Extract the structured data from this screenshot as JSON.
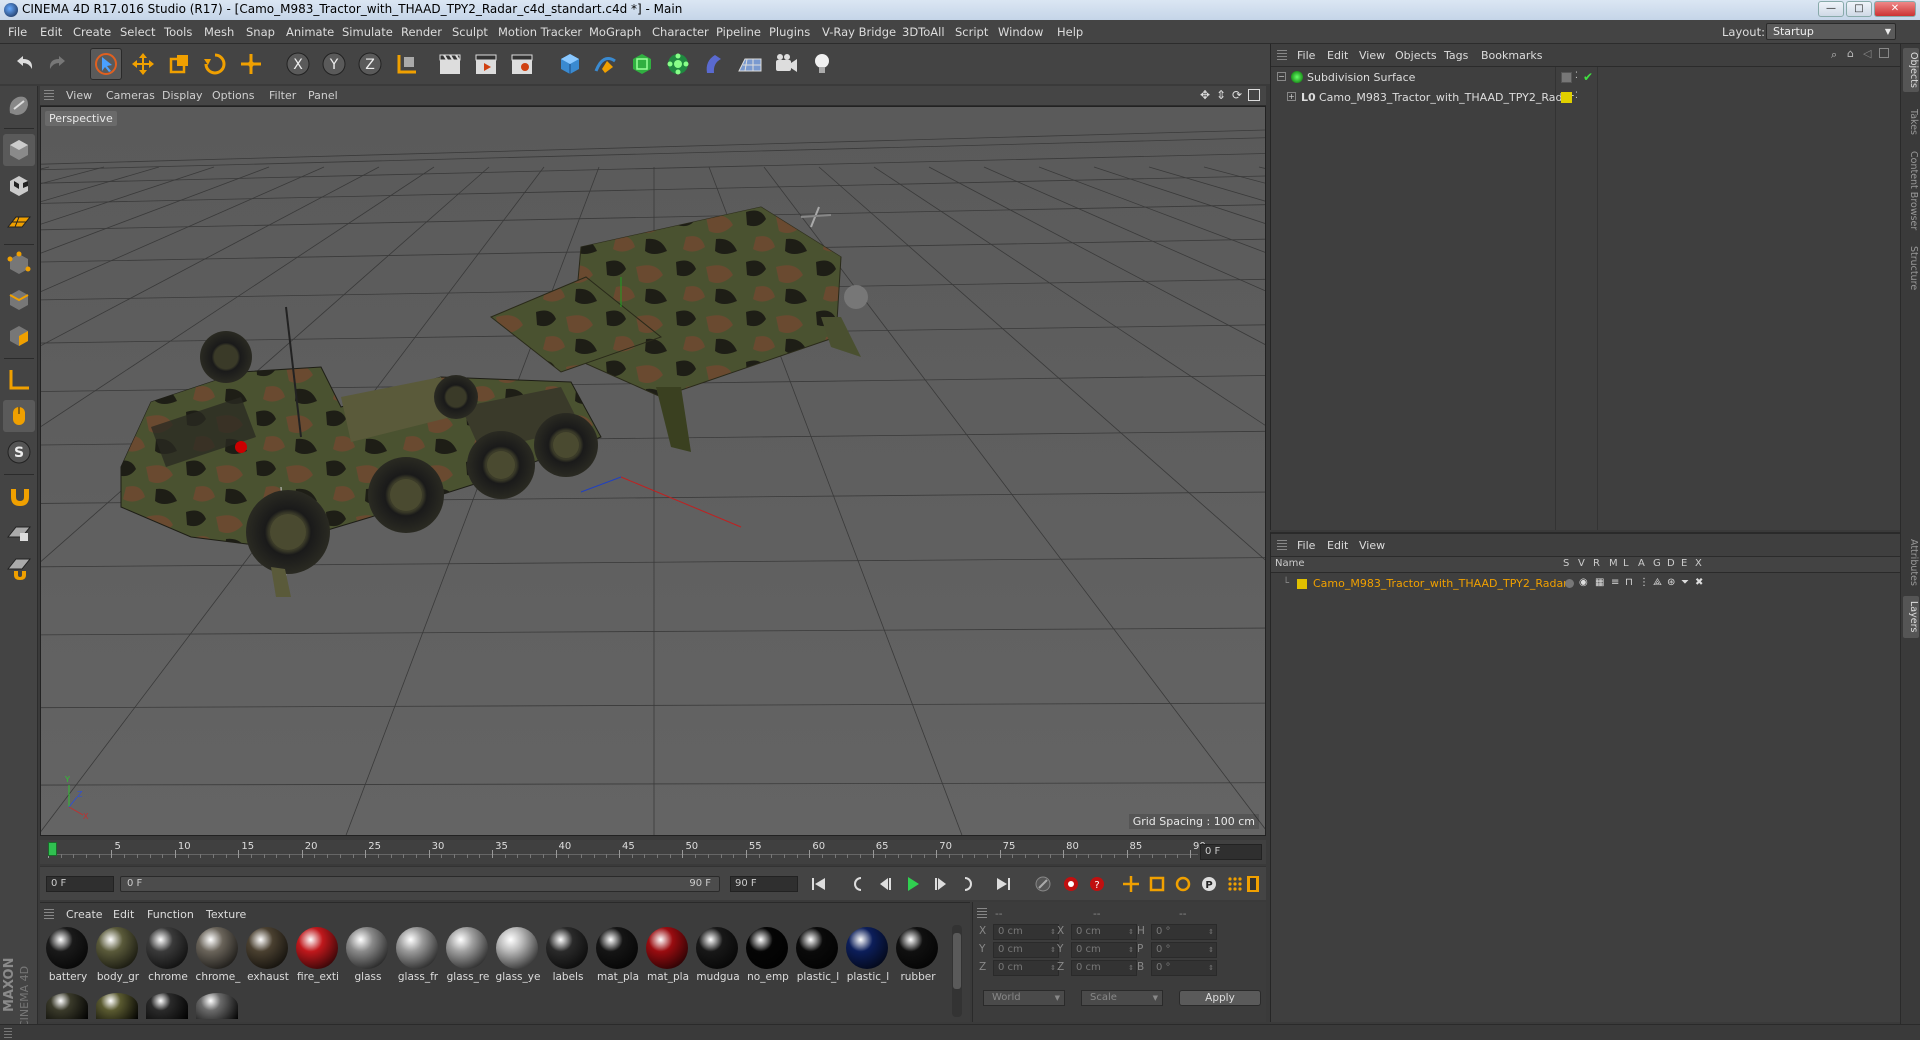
{
  "window": {
    "title": "CINEMA 4D R17.016 Studio (R17) - [Camo_M983_Tractor_with_THAAD_TPY2_Radar_c4d_standart.c4d *] - Main",
    "minimize": "—",
    "maximize": "□",
    "close": "✕"
  },
  "menu": [
    "File",
    "Edit",
    "Create",
    "Select",
    "Tools",
    "Mesh",
    "Snap",
    "Animate",
    "Simulate",
    "Render",
    "Sculpt",
    "Motion Tracker",
    "MoGraph",
    "Character",
    "Pipeline",
    "Plugins",
    "V-Ray Bridge",
    "3DToAll",
    "Script",
    "Window",
    "Help"
  ],
  "layout": {
    "label": "Layout:",
    "value": "Startup"
  },
  "viewport": {
    "menu": [
      "View",
      "Cameras",
      "Display",
      "Options",
      "Filter",
      "Panel"
    ],
    "label": "Perspective",
    "grid_spacing": "Grid Spacing : 100 cm"
  },
  "timeline": {
    "ticks": [
      "0",
      "5",
      "10",
      "15",
      "20",
      "25",
      "30",
      "35",
      "40",
      "45",
      "50",
      "55",
      "60",
      "65",
      "70",
      "75",
      "80",
      "85",
      "90"
    ],
    "current_frame": "0 F"
  },
  "transport": {
    "start": "0 F",
    "range_start": "0 F",
    "range_end": "90 F",
    "end": "90 F"
  },
  "material_manager": {
    "menu": [
      "Create",
      "Edit",
      "Function",
      "Texture"
    ],
    "materials": [
      {
        "name": "battery",
        "color": "#1a1a1a"
      },
      {
        "name": "body_gr",
        "color": "#5a5a3a"
      },
      {
        "name": "chrome",
        "color": "#3a3a3a"
      },
      {
        "name": "chrome_",
        "color": "#6a645a"
      },
      {
        "name": "exhaust",
        "color": "#4a4030"
      },
      {
        "name": "fire_exti",
        "color": "#c0181c"
      },
      {
        "name": "glass",
        "color": "#8a8a8a"
      },
      {
        "name": "glass_fr",
        "color": "#9a9a9a"
      },
      {
        "name": "glass_re",
        "color": "#a0a0a0"
      },
      {
        "name": "glass_ye",
        "color": "#b8b8b8"
      },
      {
        "name": "labels",
        "color": "#2a2a2a"
      },
      {
        "name": "mat_pla",
        "color": "#151515"
      },
      {
        "name": "mat_pla",
        "color": "#9a0c10"
      },
      {
        "name": "mudgua",
        "color": "#181818"
      },
      {
        "name": "no_emp",
        "color": "#050505"
      },
      {
        "name": "plastic_l",
        "color": "#0a0a0a"
      },
      {
        "name": "plastic_l",
        "color": "#0c1e5a"
      },
      {
        "name": "rubber",
        "color": "#101010"
      }
    ],
    "row2": [
      {
        "color": "#3a3a2a"
      },
      {
        "color": "#5a5a30"
      },
      {
        "color": "#2a2a2a"
      },
      {
        "color": "#6a6a6a"
      }
    ],
    "brand1": "MAXON",
    "brand2": "CINEMA 4D"
  },
  "coordinates": {
    "header": [
      "--",
      "--",
      "--"
    ],
    "rows": [
      {
        "a": "X",
        "av": "0 cm",
        "b": "X",
        "bv": "0 cm",
        "c": "H",
        "cv": "0 °"
      },
      {
        "a": "Y",
        "av": "0 cm",
        "b": "Y",
        "bv": "0 cm",
        "c": "P",
        "cv": "0 °"
      },
      {
        "a": "Z",
        "av": "0 cm",
        "b": "Z",
        "bv": "0 cm",
        "c": "B",
        "cv": "0 °"
      }
    ],
    "mode": "World",
    "size_mode": "Scale",
    "apply": "Apply"
  },
  "object_manager": {
    "menu": [
      "File",
      "Edit",
      "View",
      "Objects",
      "Tags",
      "Bookmarks"
    ],
    "objects": [
      {
        "name": "Subdivision Surface"
      },
      {
        "name": "Camo_M983_Tractor_with_THAAD_TPY2_Radar"
      }
    ]
  },
  "layer_manager": {
    "menu": [
      "File",
      "Edit",
      "View"
    ],
    "columns": [
      "Name",
      "S",
      "V",
      "R",
      "M",
      "L",
      "A",
      "G",
      "D",
      "E",
      "X"
    ],
    "layers": [
      {
        "name": "Camo_M983_Tractor_with_THAAD_TPY2_Radar",
        "color": "#e0c000"
      }
    ]
  },
  "right_tabs": [
    "Objects",
    "Takes",
    "Content Browser",
    "Structure",
    "Attributes",
    "Layers"
  ],
  "colors": {
    "accent_orange": "#f0a000",
    "viewport_bg": "#5e5e5e",
    "panel_bg": "#3f3f3f"
  }
}
